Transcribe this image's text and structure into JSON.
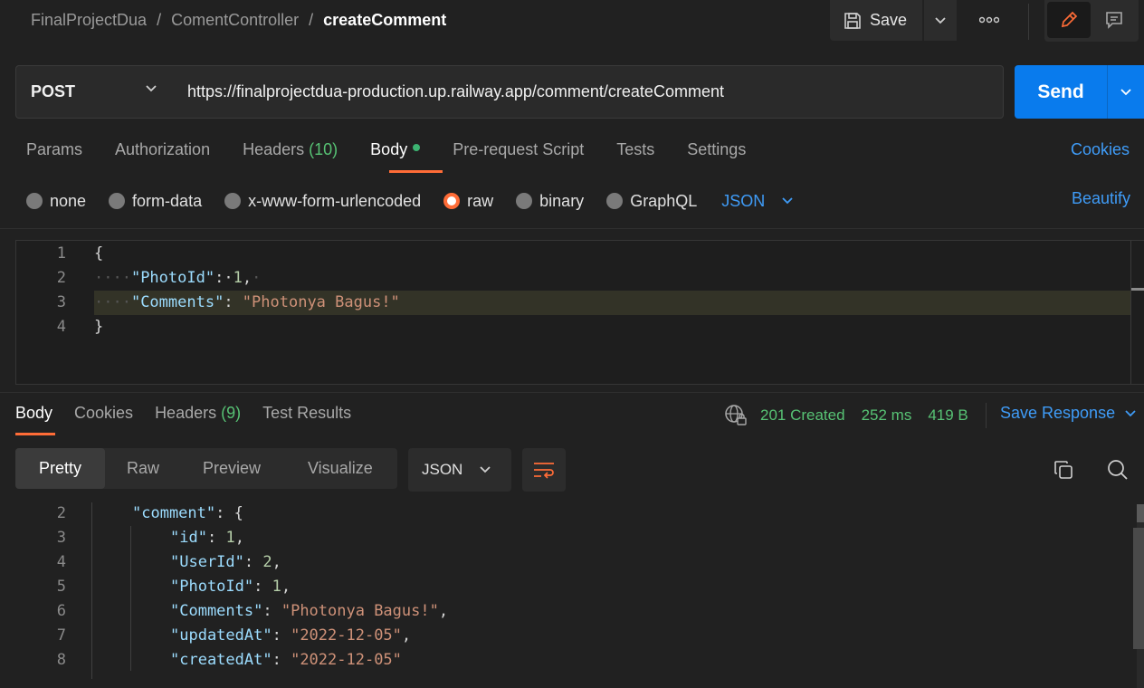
{
  "breadcrumb": {
    "collection": "FinalProjectDua",
    "folder": "ComentController",
    "request": "createComment",
    "separator": "/"
  },
  "toolbar": {
    "save_label": "Save",
    "more_label": "ooo"
  },
  "request": {
    "method": "POST",
    "url": "https://finalprojectdua-production.up.railway.app/comment/createComment",
    "send_label": "Send"
  },
  "request_tabs": [
    {
      "label": "Params"
    },
    {
      "label": "Authorization"
    },
    {
      "label": "Headers",
      "count": "(10)"
    },
    {
      "label": "Body",
      "active": true
    },
    {
      "label": "Pre-request Script"
    },
    {
      "label": "Tests"
    },
    {
      "label": "Settings"
    }
  ],
  "cookies_label": "Cookies",
  "body_types": [
    "none",
    "form-data",
    "x-www-form-urlencoded",
    "raw",
    "binary",
    "GraphQL"
  ],
  "body_type_selected": "raw",
  "body_format": "JSON",
  "beautify_label": "Beautify",
  "request_body": {
    "line_numbers": [
      "1",
      "2",
      "3",
      "4"
    ],
    "open_brace": "{",
    "photo_key": "\"PhotoId\"",
    "photo_value": "1",
    "comments_key": "\"Comments\"",
    "comments_value": "\"Photonya Bagus!\"",
    "close_brace": "}"
  },
  "response_tabs": [
    {
      "label": "Body",
      "active": true
    },
    {
      "label": "Cookies"
    },
    {
      "label": "Headers",
      "count": "(9)"
    },
    {
      "label": "Test Results"
    }
  ],
  "response_status": {
    "status": "201 Created",
    "time": "252 ms",
    "size": "419 B"
  },
  "save_response_label": "Save Response",
  "view_modes": [
    "Pretty",
    "Raw",
    "Preview",
    "Visualize"
  ],
  "response_format": "JSON",
  "response_body": {
    "line_numbers": [
      "2",
      "3",
      "4",
      "5",
      "6",
      "7",
      "8"
    ],
    "comment_key": "\"comment\"",
    "id_key": "\"id\"",
    "id_value": "1",
    "user_key": "\"UserId\"",
    "user_value": "2",
    "photo_key": "\"PhotoId\"",
    "photo_value": "1",
    "comments_key": "\"Comments\"",
    "comments_value": "\"Photonya Bagus!\"",
    "updated_key": "\"updatedAt\"",
    "updated_value": "\"2022-12-05\"",
    "created_key": "\"createdAt\"",
    "created_value": "\"2022-12-05\""
  },
  "colors": {
    "accent": "#ff6c37",
    "primary": "#097bed",
    "link": "#3f9cf8",
    "success": "#57c274",
    "json_key": "#9cdcfe",
    "json_string": "#ce9178",
    "json_number": "#b5cea8"
  }
}
